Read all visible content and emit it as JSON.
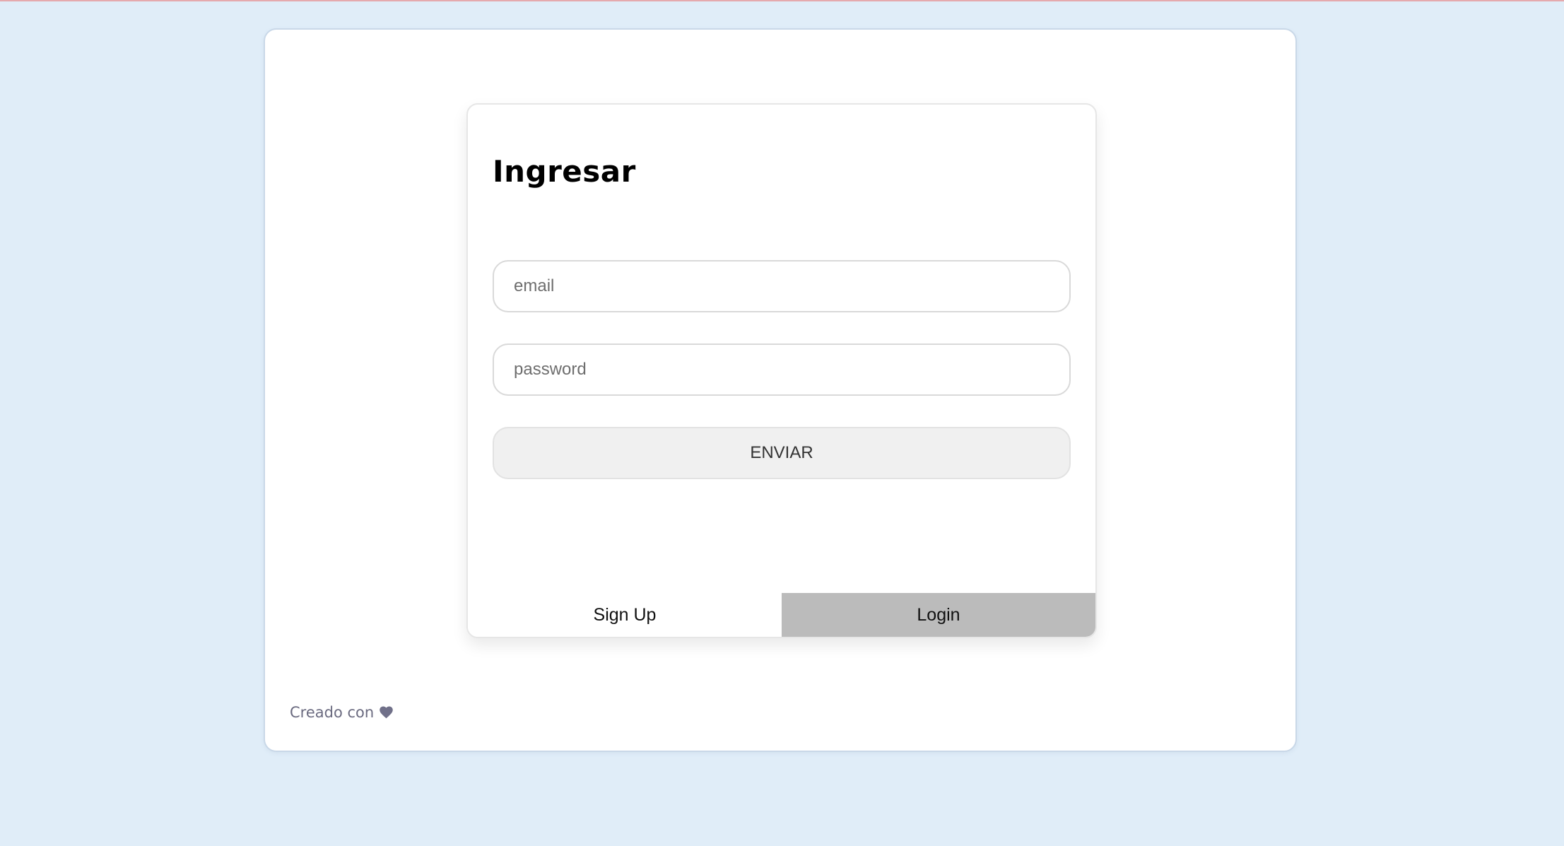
{
  "colors": {
    "page_background": "#e0edf8",
    "top_border": "#e5a9ad",
    "card_background": "#ffffff",
    "login_tab_background": "#bbbbbb",
    "submit_background": "#f0f0f0",
    "footer_text": "#6b6b80"
  },
  "login": {
    "title": "Ingresar",
    "email_placeholder": "email",
    "email_value": "",
    "password_placeholder": "password",
    "password_value": "",
    "submit_label": "ENVIAR"
  },
  "tabs": [
    {
      "label": "Sign Up",
      "active": false
    },
    {
      "label": "Login",
      "active": true
    }
  ],
  "footer": {
    "text": "Creado con",
    "icon": "heart-icon"
  }
}
